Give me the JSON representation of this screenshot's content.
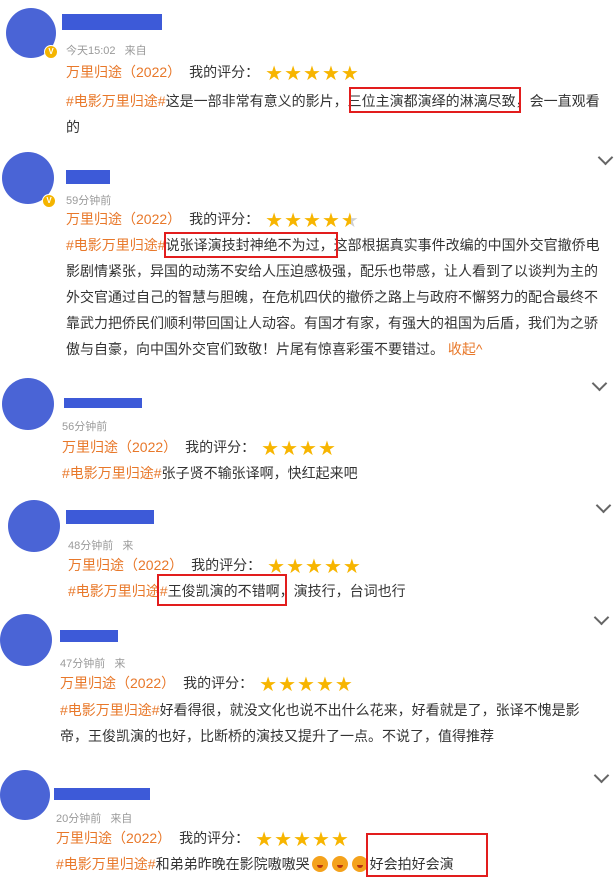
{
  "comments": [
    {
      "time": "今天15:02",
      "source": "来自",
      "movie": "万里归途（2022）",
      "rating_label": "我的评分：",
      "stars": 5,
      "tag": "#电影万里归途#",
      "lines": [
        "这是一部非常有意义的影片，三位主演都演绎的淋漓尽致，会一直观看",
        "的"
      ],
      "highlight": "三位主演都演绎的淋漓尽致"
    },
    {
      "time": "59分钟前",
      "source": "",
      "movie": "万里归途（2022）",
      "rating_label": "我的评分：",
      "stars": 4.5,
      "tag": "#电影万里归途#",
      "lines": [
        "说张译演技封神绝不为过，这部根据真实事件改编的中国外交官撤侨电",
        "影剧情紧张，异国的动荡不安给人压迫感极强，配乐也带感，让人看到了以谈判为主的",
        "外交官通过自己的智慧与胆魄，在危机四伏的撤侨之路上与政府不懈努力的配合最终不",
        "靠武力把侨民们顺利带回国让人动容。有国才有家，有强大的祖国为后盾，我们为之骄",
        "傲与自豪，向中国外交官们致敬！片尾有惊喜彩蛋不要错过。"
      ],
      "collapse": "收起^",
      "highlight": "说张译演技封神绝不为过，"
    },
    {
      "time": "56分钟前",
      "source": "",
      "movie": "万里归途（2022）",
      "rating_label": "我的评分：",
      "stars": 4,
      "tag": "#电影万里归途#",
      "lines": [
        "张子贤不输张译啊，快红起来吧"
      ]
    },
    {
      "time": "48分钟前",
      "source": "来",
      "movie": "万里归途（2022）",
      "rating_label": "我的评分：",
      "stars": 5,
      "tag": "#电影万里归途#",
      "lines": [
        "王俊凯演的不错啊，演技行，台词也行"
      ],
      "highlight": "王俊凯演的不错啊"
    },
    {
      "time": "47分钟前",
      "source": "来",
      "movie": "万里归途（2022）",
      "rating_label": "我的评分：",
      "stars": 5,
      "tag": "#电影万里归途#",
      "lines": [
        "好看得很，就没文化也说不出什么花来，好看就是了，张译不愧是影",
        "帝，王俊凯演的也好，比断桥的演技又提升了一点。不说了，值得推荐"
      ]
    },
    {
      "time": "20分钟前",
      "source": "来自",
      "movie": "万里归途（2022）",
      "rating_label": "我的评分：",
      "stars": 5,
      "tag": "#电影万里归途#",
      "lines": [
        "和弟弟昨晚在影院嗷嗷哭"
      ],
      "tail": "好会拍好会演",
      "highlight": "好会拍好会演"
    }
  ]
}
